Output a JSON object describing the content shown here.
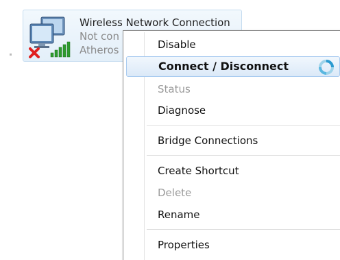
{
  "connection": {
    "name": "Wireless Network Connection",
    "status": "Not con",
    "adapter": "Atheros",
    "icon": "wireless-network-icon"
  },
  "menu": {
    "items": [
      {
        "label": "Disable"
      },
      {
        "label": "Connect / Disconnect"
      },
      {
        "label": "Status"
      },
      {
        "label": "Diagnose"
      },
      {
        "label": "Bridge Connections"
      },
      {
        "label": "Create Shortcut"
      },
      {
        "label": "Delete"
      },
      {
        "label": "Rename"
      },
      {
        "label": "Properties"
      }
    ]
  },
  "colors": {
    "highlight": "#dbe9f8",
    "disabled_text": "#9a9a9a",
    "status_red_x": "#e02020",
    "signal_green": "#2e9b2e"
  }
}
